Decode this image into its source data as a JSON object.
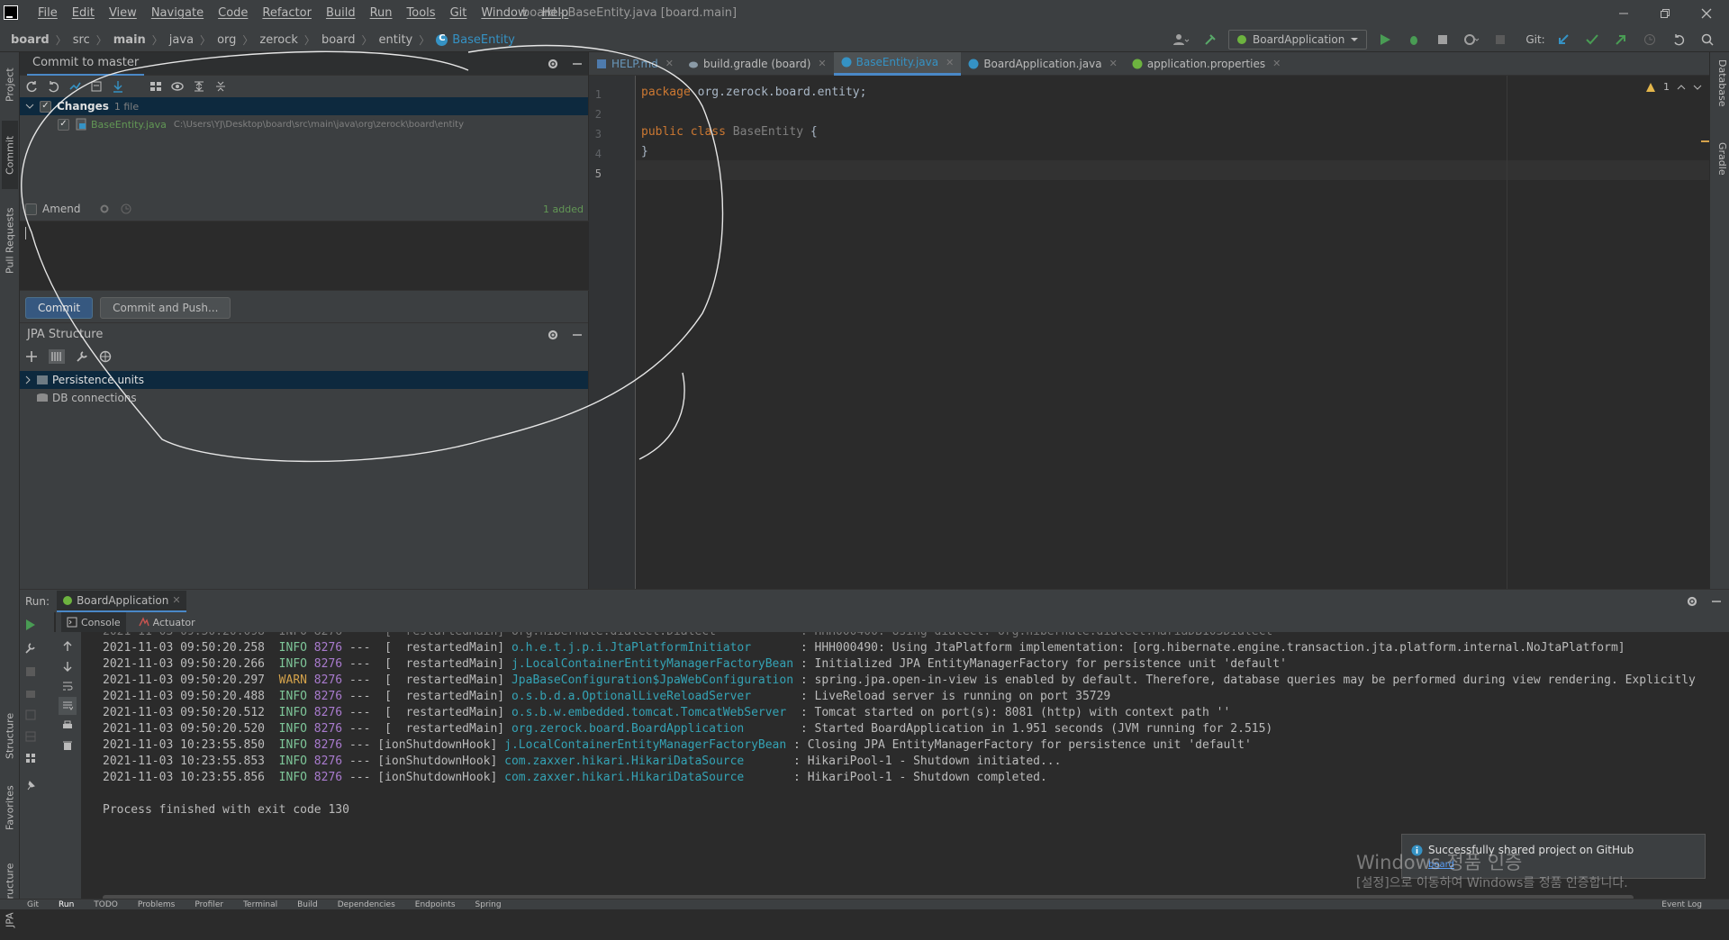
{
  "window": {
    "title": "board - BaseEntity.java [board.main]",
    "menus": [
      "File",
      "Edit",
      "View",
      "Navigate",
      "Code",
      "Refactor",
      "Build",
      "Run",
      "Tools",
      "Git",
      "Window",
      "Help"
    ]
  },
  "breadcrumb": [
    "board",
    "src",
    "main",
    "java",
    "org",
    "zerock",
    "board",
    "entity",
    "BaseEntity"
  ],
  "toolbar": {
    "run_config": "BoardApplication",
    "git_label": "Git:"
  },
  "left_strip": [
    "Project",
    "Commit",
    "Pull Requests",
    "Structure",
    "Favorites",
    "JPA Structure"
  ],
  "right_strip": [
    "Database",
    "Gradle"
  ],
  "commit_panel": {
    "title": "Commit to master",
    "changes_label": "Changes",
    "changes_count": "1 file",
    "file_name": "BaseEntity.java",
    "file_path": "C:\\Users\\YJ\\Desktop\\board\\src\\main\\java\\org\\zerock\\board\\entity",
    "amend_label": "Amend",
    "added_label": "1 added",
    "commit_button": "Commit",
    "commit_push_button": "Commit and Push..."
  },
  "jpa_panel": {
    "title": "JPA Structure",
    "items": [
      "Persistence units",
      "DB connections"
    ]
  },
  "editor": {
    "tabs": [
      {
        "label": "HELP.md",
        "active": false
      },
      {
        "label": "build.gradle (board)",
        "active": false
      },
      {
        "label": "BaseEntity.java",
        "active": true
      },
      {
        "label": "BoardApplication.java",
        "active": false
      },
      {
        "label": "application.properties",
        "active": false
      }
    ],
    "line_numbers": [
      "1",
      "2",
      "3",
      "4",
      "5"
    ],
    "code": {
      "l1_kw": "package",
      "l1_rest": " org.zerock.board.entity;",
      "l3_kw": "public class",
      "l3_cls": " BaseEntity",
      "l3_rest": " {",
      "l4": "}"
    },
    "warning_count": "1"
  },
  "run_panel": {
    "label": "Run:",
    "tab": "BoardApplication",
    "subtabs": [
      "Console",
      "Actuator"
    ],
    "logs": [
      {
        "ts": "2021-11-03 09:50:20.258",
        "lvl": "INFO",
        "pid": "8276",
        "thread": "---  [  restartedMain]",
        "logger": "o.h.e.t.j.p.i.JtaPlatformInitiator       ",
        "msg": ": HHH000490: Using JtaPlatform implementation: [org.hibernate.engine.transaction.jta.platform.internal.NoJtaPlatform]"
      },
      {
        "ts": "2021-11-03 09:50:20.266",
        "lvl": "INFO",
        "pid": "8276",
        "thread": "---  [  restartedMain]",
        "logger": "j.LocalContainerEntityManagerFactoryBean",
        "msg": " : Initialized JPA EntityManagerFactory for persistence unit 'default'"
      },
      {
        "ts": "2021-11-03 09:50:20.297",
        "lvl": "WARN",
        "pid": "8276",
        "thread": "---  [  restartedMain]",
        "logger": "JpaBaseConfiguration$JpaWebConfiguration",
        "msg": " : spring.jpa.open-in-view is enabled by default. Therefore, database queries may be performed during view rendering. Explicitly"
      },
      {
        "ts": "2021-11-03 09:50:20.488",
        "lvl": "INFO",
        "pid": "8276",
        "thread": "---  [  restartedMain]",
        "logger": "o.s.b.d.a.OptionalLiveReloadServer      ",
        "msg": " : LiveReload server is running on port 35729"
      },
      {
        "ts": "2021-11-03 09:50:20.512",
        "lvl": "INFO",
        "pid": "8276",
        "thread": "---  [  restartedMain]",
        "logger": "o.s.b.w.embedded.tomcat.TomcatWebServer ",
        "msg": " : Tomcat started on port(s): 8081 (http) with context path ''"
      },
      {
        "ts": "2021-11-03 09:50:20.520",
        "lvl": "INFO",
        "pid": "8276",
        "thread": "---  [  restartedMain]",
        "logger": "org.zerock.board.BoardApplication       ",
        "msg": " : Started BoardApplication in 1.951 seconds (JVM running for 2.515)"
      },
      {
        "ts": "2021-11-03 10:23:55.850",
        "lvl": "INFO",
        "pid": "8276",
        "thread": "--- [ionShutdownHook]",
        "logger": "j.LocalContainerEntityManagerFactoryBean",
        "msg": " : Closing JPA EntityManagerFactory for persistence unit 'default'"
      },
      {
        "ts": "2021-11-03 10:23:55.853",
        "lvl": "INFO",
        "pid": "8276",
        "thread": "--- [ionShutdownHook]",
        "logger": "com.zaxxer.hikari.HikariDataSource      ",
        "msg": " : HikariPool-1 - Shutdown initiated..."
      },
      {
        "ts": "2021-11-03 10:23:55.856",
        "lvl": "INFO",
        "pid": "8276",
        "thread": "--- [ionShutdownHook]",
        "logger": "com.zaxxer.hikari.HikariDataSource      ",
        "msg": " : HikariPool-1 - Shutdown completed."
      }
    ],
    "exit_line": "Process finished with exit code 130"
  },
  "notification": {
    "text": "Successfully shared project on GitHub",
    "link": "board"
  },
  "watermark": {
    "line1": "Windows 정품 인증",
    "line2": "[설정]으로 이동하여 Windows를 정품 인증합니다."
  },
  "status_tabs": [
    "Git",
    "Run",
    "TODO",
    "Problems",
    "Profiler",
    "Terminal",
    "Build",
    "Dependencies",
    "Endpoints",
    "Spring"
  ],
  "event_log": "Event Log",
  "colors": {
    "accent": "#3592c4",
    "selection": "#0d293e",
    "bg": "#2b2b2b",
    "panel": "#3c3f41"
  }
}
